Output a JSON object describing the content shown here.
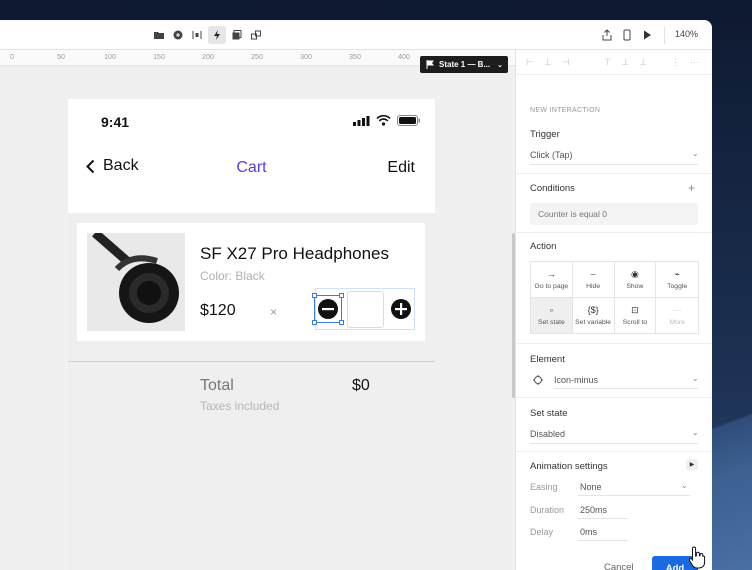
{
  "toolbar": {
    "zoom": "140%",
    "left_icons": [
      "folder-icon",
      "component-icon",
      "distribute-icon",
      "lightning-icon",
      "layers-icon",
      "link-icon"
    ],
    "right_icons": [
      "export-icon",
      "device-icon",
      "play-icon"
    ]
  },
  "ruler": {
    "ticks": [
      "0",
      "50",
      "100",
      "150",
      "200",
      "250",
      "300",
      "350",
      "400"
    ]
  },
  "state_chip": {
    "label": "State 1 — B..."
  },
  "phone": {
    "time": "9:41",
    "nav": {
      "back": "Back",
      "title": "Cart",
      "edit": "Edit"
    },
    "item": {
      "name": "SF X27 Pro Headphones",
      "color": "Color: Black",
      "price": "$120",
      "times": "×"
    },
    "total_label": "Total",
    "total_value": "$0",
    "tax_note": "Taxes included"
  },
  "panel": {
    "header": "NEW INTERACTION",
    "trigger_label": "Trigger",
    "trigger_value": "Click (Tap)",
    "conditions_label": "Conditions",
    "conditions_add": "+",
    "condition_text": "Counter is equal 0",
    "action_label": "Action",
    "actions": [
      {
        "label": "Go to page",
        "icon": "→"
      },
      {
        "label": "Hide",
        "icon": "⌣"
      },
      {
        "label": "Show",
        "icon": "◉"
      },
      {
        "label": "Toggle",
        "icon": "⌁"
      },
      {
        "label": "Set state",
        "icon": "▫"
      },
      {
        "label": "Set variable",
        "icon": "{$}"
      },
      {
        "label": "Scroll to",
        "icon": "⊡"
      },
      {
        "label": "More",
        "icon": "···"
      }
    ],
    "element_label": "Element",
    "element_value": "Icon-minus",
    "set_state_label": "Set state",
    "set_state_value": "Disabled",
    "animation_label": "Animation settings",
    "easing_label": "Easing",
    "easing_value": "None",
    "duration_label": "Duration",
    "duration_value": "250ms",
    "delay_label": "Delay",
    "delay_value": "0ms",
    "cancel": "Cancel",
    "add": "Add"
  },
  "colors": {
    "accent": "#1a6ae3",
    "nav_title": "#5b3ce8",
    "selection": "#3d7be0"
  }
}
